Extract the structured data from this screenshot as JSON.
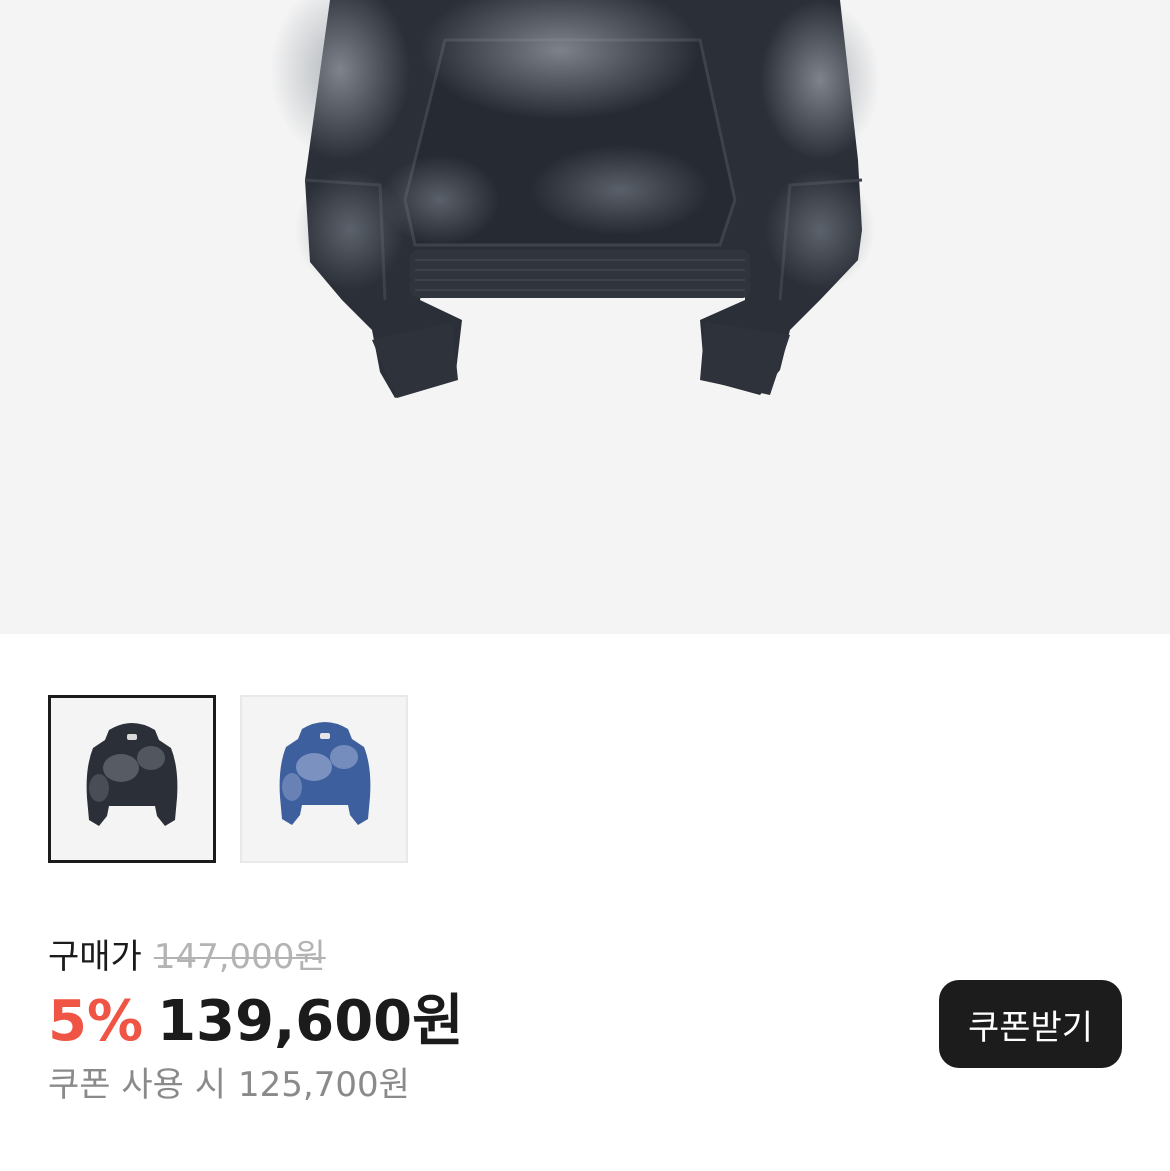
{
  "product": {
    "main_image": "black-washed-hoodie",
    "thumbnails": [
      {
        "icon": "black-hoodie-thumbnail",
        "selected": true
      },
      {
        "icon": "blue-hoodie-thumbnail",
        "selected": false
      }
    ]
  },
  "price": {
    "label": "구매가",
    "original": "147,000원",
    "discount_rate": "5%",
    "sale_price": "139,600원",
    "coupon_prefix": "쿠폰 사용 시",
    "coupon_price": "125,700원"
  },
  "coupon_button": {
    "label": "쿠폰받기"
  },
  "colors": {
    "accent_discount": "#ef5444",
    "dark": "#1b1b1b",
    "muted": "#8a8a8a",
    "strike": "#b3b3b3",
    "image_bg": "#f4f4f4"
  }
}
